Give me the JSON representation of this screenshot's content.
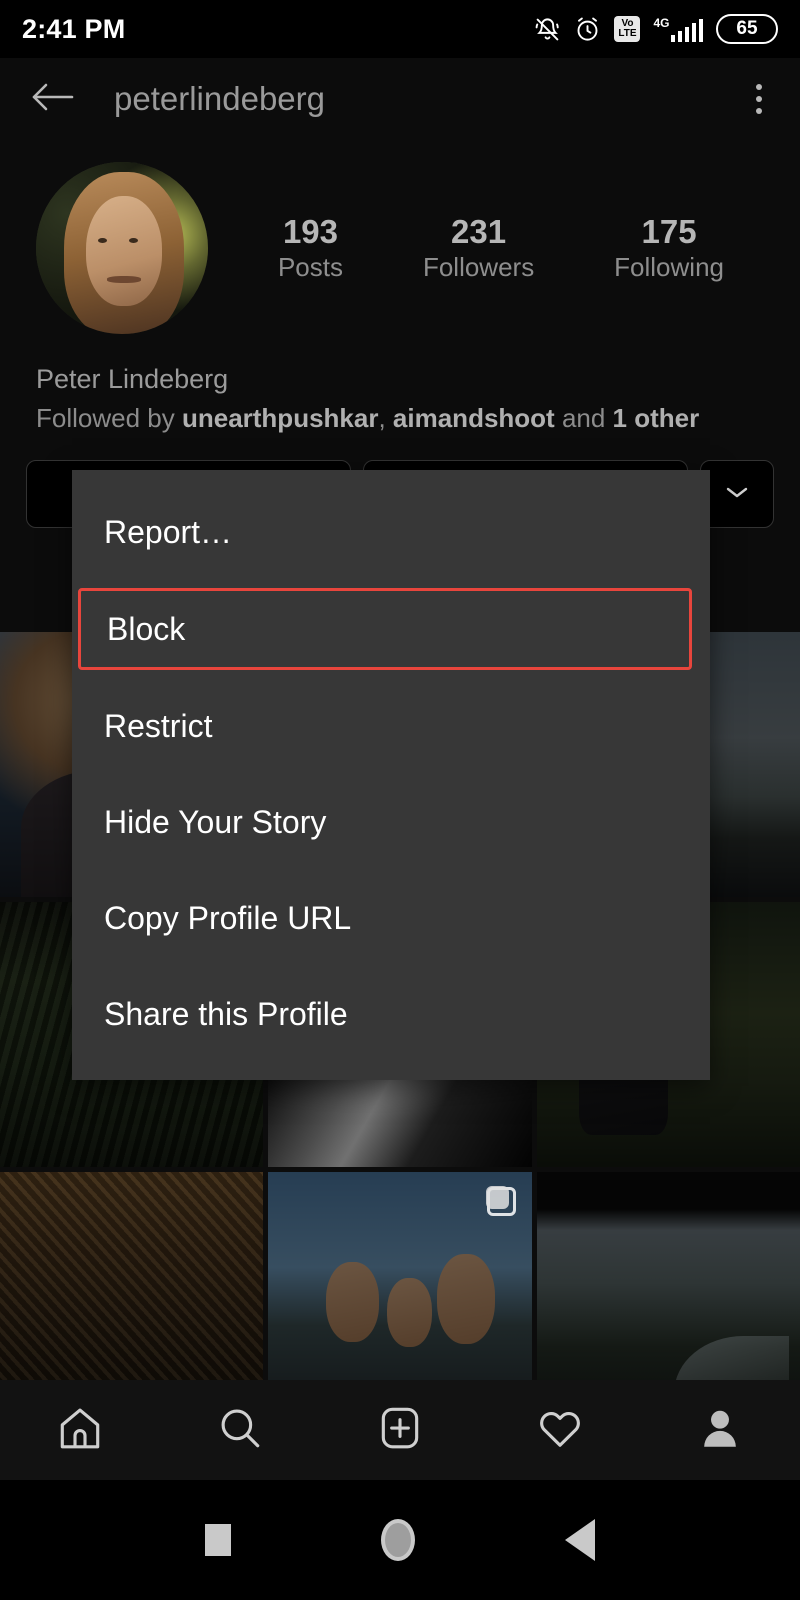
{
  "status_bar": {
    "time": "2:41 PM",
    "battery_level": "65",
    "network_type": "4G",
    "volte_top": "Vo",
    "volte_bottom": "LTE",
    "icons": [
      "bell-muted-icon",
      "alarm-clock-icon",
      "volte-icon",
      "signal-4g-icon",
      "battery-icon"
    ]
  },
  "header": {
    "back_icon": "arrow-left-icon",
    "username": "peterlindeberg",
    "overflow_icon": "kebab-menu-icon"
  },
  "profile": {
    "avatar_alt": "profile-photo",
    "full_name": "Peter Lindeberg",
    "stats": [
      {
        "count": "193",
        "label": "Posts"
      },
      {
        "count": "231",
        "label": "Followers"
      },
      {
        "count": "175",
        "label": "Following"
      }
    ],
    "followed_by": {
      "prefix": "Followed by ",
      "user_one": "unearthpushkar",
      "separator": ", ",
      "user_two": "aimandshoot",
      "conjunction": " and ",
      "others": "1 other"
    },
    "actions": {
      "primary_label": "",
      "secondary_label": "",
      "chevron_icon": "chevron-down-icon"
    }
  },
  "menu": {
    "items": [
      {
        "label": "Report…",
        "highlighted": false
      },
      {
        "label": "Block",
        "highlighted": true
      },
      {
        "label": "Restrict",
        "highlighted": false
      },
      {
        "label": "Hide Your Story",
        "highlighted": false
      },
      {
        "label": "Copy Profile URL",
        "highlighted": false
      },
      {
        "label": "Share this Profile",
        "highlighted": false
      }
    ],
    "highlight_color": "#e8453c",
    "background_color": "#373737"
  },
  "grid": {
    "cells": [
      {
        "scene": "sc-portrait",
        "name": "grid-photo-portrait",
        "carousel": false
      },
      {
        "scene": "sc-snowtrail",
        "name": "grid-photo-snow-trail",
        "carousel": false
      },
      {
        "scene": "sc-lake",
        "name": "grid-photo-lake",
        "carousel": false
      },
      {
        "scene": "sc-forest",
        "name": "grid-photo-forest-valley",
        "carousel": false
      },
      {
        "scene": "sc-snowpath",
        "name": "grid-photo-snow-path",
        "carousel": true
      },
      {
        "scene": "sc-sitting",
        "name": "grid-photo-hiker-sitting",
        "carousel": false
      },
      {
        "scene": "sc-hammock",
        "name": "grid-photo-hammock",
        "carousel": false
      },
      {
        "scene": "sc-selfie",
        "name": "grid-photo-group-selfie",
        "carousel": true
      },
      {
        "scene": "sc-river",
        "name": "grid-photo-river-valley",
        "carousel": false
      }
    ]
  },
  "bottom_nav": {
    "items": [
      {
        "icon": "home-icon",
        "name": "nav-home"
      },
      {
        "icon": "search-icon",
        "name": "nav-search"
      },
      {
        "icon": "add-post-icon",
        "name": "nav-add-post"
      },
      {
        "icon": "heart-icon",
        "name": "nav-activity"
      },
      {
        "icon": "profile-avatar-icon",
        "name": "nav-profile"
      }
    ]
  },
  "android_nav": {
    "recents_icon": "square-recents-icon",
    "home_icon": "circle-home-icon",
    "back_icon": "triangle-back-icon"
  }
}
